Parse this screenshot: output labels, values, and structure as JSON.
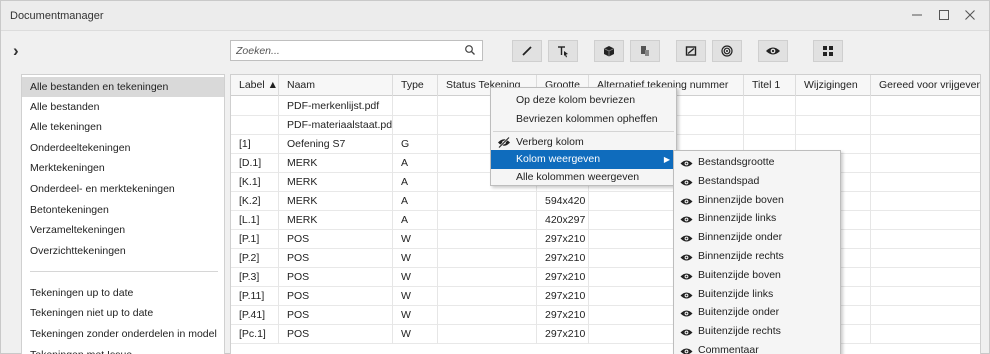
{
  "window": {
    "title": "Documentmanager",
    "controls": [
      "minimize-icon",
      "maximize-icon",
      "close-icon"
    ]
  },
  "toolbar": {
    "expand_glyph": "›",
    "search_placeholder": "Zoeken...",
    "buttons": [
      "pencil-icon",
      "cursor-pointer-icon",
      "cube-icon",
      "document-stack-icon",
      "drawing-frame-icon",
      "target-icon",
      "eye-icon",
      "grid-icon"
    ]
  },
  "sidebar": {
    "group1": [
      "Alle bestanden en tekeningen",
      "Alle bestanden",
      "Alle tekeningen",
      "Onderdeeltekeningen",
      "Merktekeningen",
      "Onderdeel- en merktekeningen",
      "Betontekeningen",
      "Verzameltekeningen",
      "Overzichttekeningen"
    ],
    "group2": [
      "Tekeningen up to date",
      "Tekeningen niet up to date",
      "Tekeningen zonder onderdelen in model",
      "Tekeningen met Issue"
    ],
    "selected": "Alle bestanden en tekeningen"
  },
  "grid": {
    "columns": [
      "Label ▲",
      "Naam",
      "Type",
      "Status Tekening",
      "Grootte",
      "Alternatief tekening nummer",
      "Titel 1",
      "Wijzigingen",
      "Gereed voor vrijgeven"
    ],
    "rows": [
      [
        "",
        "PDF-merkenlijst.pdf",
        "",
        "",
        "",
        "",
        "",
        "",
        ""
      ],
      [
        "",
        "PDF-materiaalstaat.pdf",
        "",
        "",
        "",
        "",
        "",
        "",
        ""
      ],
      [
        "[1]",
        "Oefening S7",
        "G",
        "",
        "",
        "",
        "",
        "",
        ""
      ],
      [
        "[D.1]",
        "MERK",
        "A",
        "",
        "",
        "",
        "",
        "",
        ""
      ],
      [
        "[K.1]",
        "MERK",
        "A",
        "",
        "594x420",
        "",
        "",
        "",
        ""
      ],
      [
        "[K.2]",
        "MERK",
        "A",
        "",
        "594x420",
        "",
        "",
        "",
        ""
      ],
      [
        "[L.1]",
        "MERK",
        "A",
        "",
        "420x297",
        "",
        "",
        "",
        ""
      ],
      [
        "[P.1]",
        "POS",
        "W",
        "",
        "297x210",
        "",
        "",
        "",
        ""
      ],
      [
        "[P.2]",
        "POS",
        "W",
        "",
        "297x210",
        "",
        "",
        "",
        ""
      ],
      [
        "[P.3]",
        "POS",
        "W",
        "",
        "297x210",
        "",
        "",
        "",
        ""
      ],
      [
        "[P.11]",
        "POS",
        "W",
        "",
        "297x210",
        "",
        "",
        "",
        ""
      ],
      [
        "[P.41]",
        "POS",
        "W",
        "",
        "297x210",
        "",
        "",
        "",
        ""
      ],
      [
        "[Pc.1]",
        "POS",
        "W",
        "",
        "297x210",
        "",
        "",
        "",
        ""
      ]
    ]
  },
  "context_menu": {
    "items": [
      {
        "label": "Op deze kolom bevriezen",
        "icon": ""
      },
      {
        "label": "Bevriezen kolommen opheffen",
        "icon": ""
      },
      {
        "label": "Verberg kolom",
        "icon": "eye-slash-icon"
      },
      {
        "label": "Kolom weergeven",
        "icon": "",
        "submenu_arrow": "▶"
      },
      {
        "label": "Alle kolommen weergeven",
        "icon": ""
      }
    ],
    "highlighted": "Kolom weergeven",
    "highlight_color": "#0f6cbd"
  },
  "submenu": {
    "items": [
      "Bestandsgrootte",
      "Bestandspad",
      "Binnenzijde boven",
      "Binnenzijde links",
      "Binnenzijde onder",
      "Binnenzijde rechts",
      "Buitenzijde boven",
      "Buitenzijde links",
      "Buitenzijde onder",
      "Buitenzijde rechts",
      "Commentaar"
    ],
    "icon": "eye-icon"
  }
}
